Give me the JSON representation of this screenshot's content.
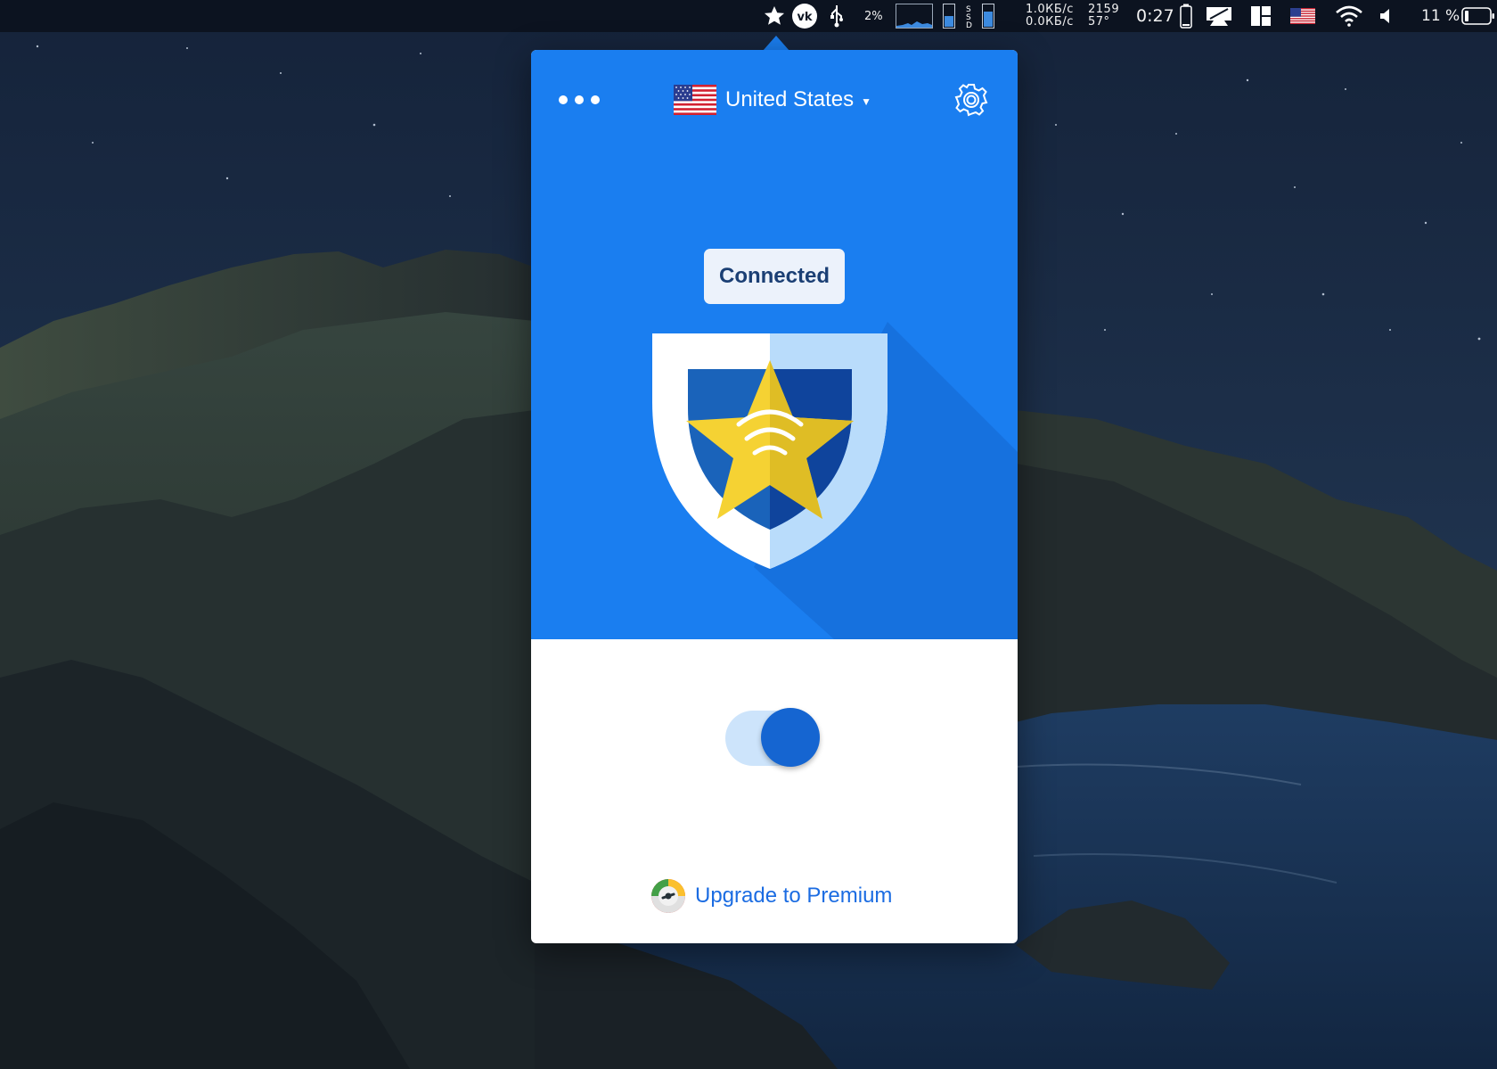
{
  "menubar": {
    "cpu_percent": "2%",
    "net_up": "1.0КБ/с",
    "net_down": "0.0КБ/с",
    "fan_rpm": "2159",
    "temperature": "57°",
    "time": "0:27",
    "battery_percent": "11 %",
    "icons": [
      "star-icon",
      "vk-icon",
      "usb-icon",
      "cpu-graph-icon",
      "memory-bar-icon",
      "ssd-icon",
      "battery-icon",
      "display-icon",
      "grid-icon",
      "us-flag-icon",
      "wifi-icon",
      "volume-icon",
      "battery-icon"
    ]
  },
  "popover": {
    "country": "United States",
    "status": "Connected",
    "upgrade_label": "Upgrade to Premium",
    "toggle_on": true,
    "icons": [
      "more-icon",
      "us-flag-icon",
      "gear-icon",
      "shield-icon",
      "speedometer-icon"
    ]
  },
  "colors": {
    "accent_blue": "#1a7ef0",
    "toggle_knob": "#1565d1",
    "toggle_track": "#cde4fb",
    "badge_bg": "#ecf2fb",
    "link_blue": "#1b6ce2",
    "star_yellow": "#f5d233"
  }
}
